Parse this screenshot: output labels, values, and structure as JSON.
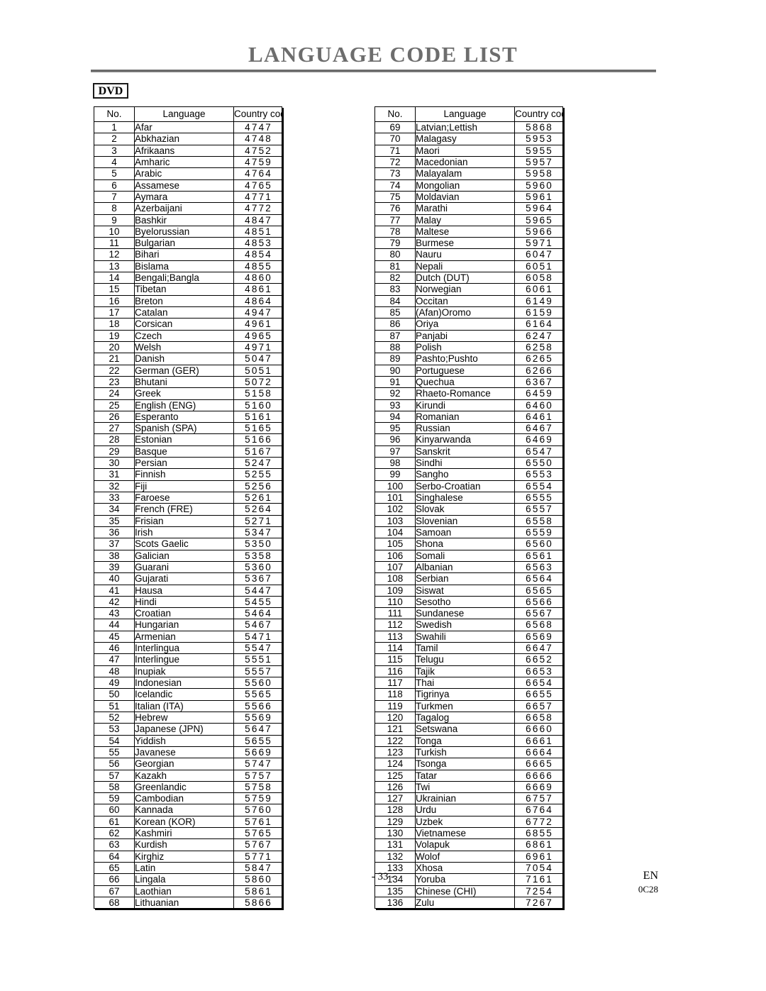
{
  "page": {
    "title": "LANGUAGE CODE LIST",
    "badge": "DVD",
    "footer_page": "- 33 -",
    "footer_language": "EN",
    "footer_code": "0C28",
    "title_color": "#6d6d6d",
    "rule_color": "#595959",
    "text_color": "#000000"
  },
  "table": {
    "headers": {
      "no": "No.",
      "language": "Language",
      "country_code": "Country code"
    },
    "left_rows": [
      {
        "no": "1",
        "language": "Afar",
        "code": "4747"
      },
      {
        "no": "2",
        "language": "Abkhazian",
        "code": "4748"
      },
      {
        "no": "3",
        "language": "Afrikaans",
        "code": "4752"
      },
      {
        "no": "4",
        "language": "Amharic",
        "code": "4759"
      },
      {
        "no": "5",
        "language": "Arabic",
        "code": "4764"
      },
      {
        "no": "6",
        "language": "Assamese",
        "code": "4765"
      },
      {
        "no": "7",
        "language": "Aymara",
        "code": "4771"
      },
      {
        "no": "8",
        "language": "Azerbaijani",
        "code": "4772"
      },
      {
        "no": "9",
        "language": "Bashkir",
        "code": "4847"
      },
      {
        "no": "10",
        "language": "Byelorussian",
        "code": "4851"
      },
      {
        "no": "11",
        "language": "Bulgarian",
        "code": "4853"
      },
      {
        "no": "12",
        "language": "Bihari",
        "code": "4854"
      },
      {
        "no": "13",
        "language": "Bislama",
        "code": "4855"
      },
      {
        "no": "14",
        "language": "Bengali;Bangla",
        "code": "4860"
      },
      {
        "no": "15",
        "language": "Tibetan",
        "code": "4861"
      },
      {
        "no": "16",
        "language": "Breton",
        "code": "4864"
      },
      {
        "no": "17",
        "language": "Catalan",
        "code": "4947"
      },
      {
        "no": "18",
        "language": "Corsican",
        "code": "4961"
      },
      {
        "no": "19",
        "language": "Czech",
        "code": "4965"
      },
      {
        "no": "20",
        "language": "Welsh",
        "code": "4971"
      },
      {
        "no": "21",
        "language": "Danish",
        "code": "5047"
      },
      {
        "no": "22",
        "language": "German (GER)",
        "code": "5051"
      },
      {
        "no": "23",
        "language": "Bhutani",
        "code": "5072"
      },
      {
        "no": "24",
        "language": "Greek",
        "code": "5158"
      },
      {
        "no": "25",
        "language": "English (ENG)",
        "code": "5160"
      },
      {
        "no": "26",
        "language": "Esperanto",
        "code": "5161"
      },
      {
        "no": "27",
        "language": "Spanish (SPA)",
        "code": "5165"
      },
      {
        "no": "28",
        "language": "Estonian",
        "code": "5166"
      },
      {
        "no": "29",
        "language": "Basque",
        "code": "5167"
      },
      {
        "no": "30",
        "language": "Persian",
        "code": "5247"
      },
      {
        "no": "31",
        "language": "Finnish",
        "code": "5255"
      },
      {
        "no": "32",
        "language": "Fiji",
        "code": "5256"
      },
      {
        "no": "33",
        "language": "Faroese",
        "code": "5261"
      },
      {
        "no": "34",
        "language": "French (FRE)",
        "code": "5264"
      },
      {
        "no": "35",
        "language": "Frisian",
        "code": "5271"
      },
      {
        "no": "36",
        "language": "Irish",
        "code": "5347"
      },
      {
        "no": "37",
        "language": "Scots Gaelic",
        "code": "5350"
      },
      {
        "no": "38",
        "language": "Galician",
        "code": "5358"
      },
      {
        "no": "39",
        "language": "Guarani",
        "code": "5360"
      },
      {
        "no": "40",
        "language": "Gujarati",
        "code": "5367"
      },
      {
        "no": "41",
        "language": "Hausa",
        "code": "5447"
      },
      {
        "no": "42",
        "language": "Hindi",
        "code": "5455"
      },
      {
        "no": "43",
        "language": "Croatian",
        "code": "5464"
      },
      {
        "no": "44",
        "language": "Hungarian",
        "code": "5467"
      },
      {
        "no": "45",
        "language": "Armenian",
        "code": "5471"
      },
      {
        "no": "46",
        "language": "Interlingua",
        "code": "5547"
      },
      {
        "no": "47",
        "language": "Interlingue",
        "code": "5551"
      },
      {
        "no": "48",
        "language": "Inupiak",
        "code": "5557"
      },
      {
        "no": "49",
        "language": "Indonesian",
        "code": "5560"
      },
      {
        "no": "50",
        "language": "Icelandic",
        "code": "5565"
      },
      {
        "no": "51",
        "language": "Italian (ITA)",
        "code": "5566"
      },
      {
        "no": "52",
        "language": "Hebrew",
        "code": "5569"
      },
      {
        "no": "53",
        "language": "Japanese (JPN)",
        "code": "5647"
      },
      {
        "no": "54",
        "language": "Yiddish",
        "code": "5655"
      },
      {
        "no": "55",
        "language": "Javanese",
        "code": "5669"
      },
      {
        "no": "56",
        "language": "Georgian",
        "code": "5747"
      },
      {
        "no": "57",
        "language": "Kazakh",
        "code": "5757"
      },
      {
        "no": "58",
        "language": "Greenlandic",
        "code": "5758"
      },
      {
        "no": "59",
        "language": "Cambodian",
        "code": "5759"
      },
      {
        "no": "60",
        "language": "Kannada",
        "code": "5760"
      },
      {
        "no": "61",
        "language": "Korean (KOR)",
        "code": "5761"
      },
      {
        "no": "62",
        "language": "Kashmiri",
        "code": "5765"
      },
      {
        "no": "63",
        "language": "Kurdish",
        "code": "5767"
      },
      {
        "no": "64",
        "language": "Kirghiz",
        "code": "5771"
      },
      {
        "no": "65",
        "language": "Latin",
        "code": "5847"
      },
      {
        "no": "66",
        "language": "Lingala",
        "code": "5860"
      },
      {
        "no": "67",
        "language": "Laothian",
        "code": "5861"
      },
      {
        "no": "68",
        "language": "Lithuanian",
        "code": "5866"
      }
    ],
    "right_rows": [
      {
        "no": "69",
        "language": "Latvian;Lettish",
        "code": "5868"
      },
      {
        "no": "70",
        "language": "Malagasy",
        "code": "5953"
      },
      {
        "no": "71",
        "language": "Maori",
        "code": "5955"
      },
      {
        "no": "72",
        "language": "Macedonian",
        "code": "5957"
      },
      {
        "no": "73",
        "language": "Malayalam",
        "code": "5958"
      },
      {
        "no": "74",
        "language": "Mongolian",
        "code": "5960"
      },
      {
        "no": "75",
        "language": "Moldavian",
        "code": "5961"
      },
      {
        "no": "76",
        "language": "Marathi",
        "code": "5964"
      },
      {
        "no": "77",
        "language": "Malay",
        "code": "5965"
      },
      {
        "no": "78",
        "language": "Maltese",
        "code": "5966"
      },
      {
        "no": "79",
        "language": "Burmese",
        "code": "5971"
      },
      {
        "no": "80",
        "language": "Nauru",
        "code": "6047"
      },
      {
        "no": "81",
        "language": "Nepali",
        "code": "6051"
      },
      {
        "no": "82",
        "language": "Dutch (DUT)",
        "code": "6058"
      },
      {
        "no": "83",
        "language": "Norwegian",
        "code": "6061"
      },
      {
        "no": "84",
        "language": "Occitan",
        "code": "6149"
      },
      {
        "no": "85",
        "language": "(Afan)Oromo",
        "code": "6159"
      },
      {
        "no": "86",
        "language": "Oriya",
        "code": "6164"
      },
      {
        "no": "87",
        "language": "Panjabi",
        "code": "6247"
      },
      {
        "no": "88",
        "language": "Polish",
        "code": "6258"
      },
      {
        "no": "89",
        "language": "Pashto;Pushto",
        "code": "6265"
      },
      {
        "no": "90",
        "language": "Portuguese",
        "code": "6266"
      },
      {
        "no": "91",
        "language": "Quechua",
        "code": "6367"
      },
      {
        "no": "92",
        "language": "Rhaeto-Romance",
        "code": "6459"
      },
      {
        "no": "93",
        "language": "Kirundi",
        "code": "6460"
      },
      {
        "no": "94",
        "language": "Romanian",
        "code": "6461"
      },
      {
        "no": "95",
        "language": "Russian",
        "code": "6467"
      },
      {
        "no": "96",
        "language": "Kinyarwanda",
        "code": "6469"
      },
      {
        "no": "97",
        "language": "Sanskrit",
        "code": "6547"
      },
      {
        "no": "98",
        "language": "Sindhi",
        "code": "6550"
      },
      {
        "no": "99",
        "language": "Sangho",
        "code": "6553"
      },
      {
        "no": "100",
        "language": "Serbo-Croatian",
        "code": "6554"
      },
      {
        "no": "101",
        "language": "Singhalese",
        "code": "6555"
      },
      {
        "no": "102",
        "language": "Slovak",
        "code": "6557"
      },
      {
        "no": "103",
        "language": "Slovenian",
        "code": "6558"
      },
      {
        "no": "104",
        "language": "Samoan",
        "code": "6559"
      },
      {
        "no": "105",
        "language": "Shona",
        "code": "6560"
      },
      {
        "no": "106",
        "language": "Somali",
        "code": "6561"
      },
      {
        "no": "107",
        "language": "Albanian",
        "code": "6563"
      },
      {
        "no": "108",
        "language": "Serbian",
        "code": "6564"
      },
      {
        "no": "109",
        "language": "Siswat",
        "code": "6565"
      },
      {
        "no": "110",
        "language": "Sesotho",
        "code": "6566"
      },
      {
        "no": "111",
        "language": "Sundanese",
        "code": "6567"
      },
      {
        "no": "112",
        "language": "Swedish",
        "code": "6568"
      },
      {
        "no": "113",
        "language": "Swahili",
        "code": "6569"
      },
      {
        "no": "114",
        "language": "Tamil",
        "code": "6647"
      },
      {
        "no": "115",
        "language": "Telugu",
        "code": "6652"
      },
      {
        "no": "116",
        "language": "Tajik",
        "code": "6653"
      },
      {
        "no": "117",
        "language": "Thai",
        "code": "6654"
      },
      {
        "no": "118",
        "language": "Tigrinya",
        "code": "6655"
      },
      {
        "no": "119",
        "language": "Turkmen",
        "code": "6657"
      },
      {
        "no": "120",
        "language": "Tagalog",
        "code": "6658"
      },
      {
        "no": "121",
        "language": "Setswana",
        "code": "6660"
      },
      {
        "no": "122",
        "language": "Tonga",
        "code": "6661"
      },
      {
        "no": "123",
        "language": "Turkish",
        "code": "6664"
      },
      {
        "no": "124",
        "language": "Tsonga",
        "code": "6665"
      },
      {
        "no": "125",
        "language": "Tatar",
        "code": "6666"
      },
      {
        "no": "126",
        "language": "Twi",
        "code": "6669"
      },
      {
        "no": "127",
        "language": "Ukrainian",
        "code": "6757"
      },
      {
        "no": "128",
        "language": "Urdu",
        "code": "6764"
      },
      {
        "no": "129",
        "language": "Uzbek",
        "code": "6772"
      },
      {
        "no": "130",
        "language": "Vietnamese",
        "code": "6855"
      },
      {
        "no": "131",
        "language": "Volapuk",
        "code": "6861"
      },
      {
        "no": "132",
        "language": "Wolof",
        "code": "6961"
      },
      {
        "no": "133",
        "language": "Xhosa",
        "code": "7054"
      },
      {
        "no": "134",
        "language": "Yoruba",
        "code": "7161"
      },
      {
        "no": "135",
        "language": "Chinese (CHI)",
        "code": "7254"
      },
      {
        "no": "136",
        "language": "Zulu",
        "code": "7267"
      }
    ]
  }
}
